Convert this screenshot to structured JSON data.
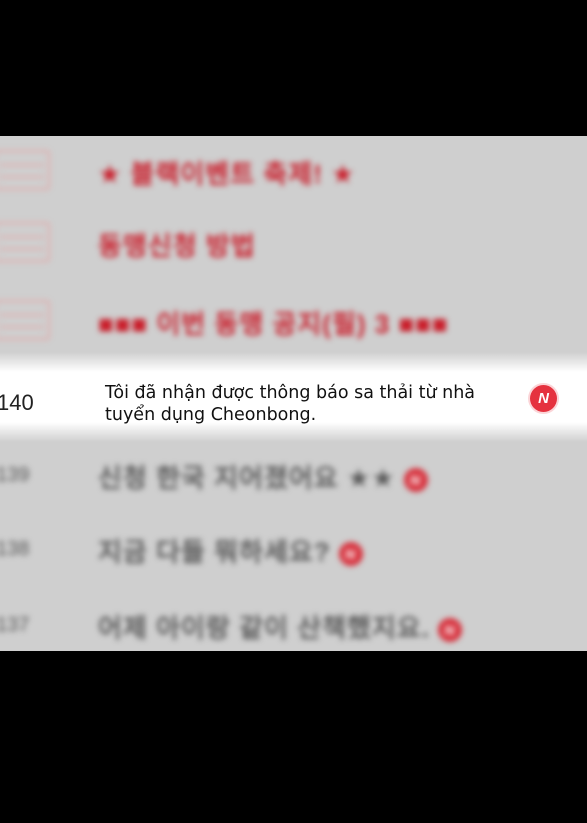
{
  "board": {
    "top_rows": [
      {
        "text": "★ 블랙이벤트 축제! ★"
      },
      {
        "text": "동맹신청 방법"
      },
      {
        "text": "■■■ 이번 동맹 공지(필) 3 ■■■"
      }
    ],
    "highlighted": {
      "number": "140",
      "title": "Tôi đã nhận được thông báo sa thải từ nhà tuyển dụng Cheonbong.",
      "badge": "N"
    },
    "bottom_rows": [
      {
        "number": "139",
        "text": "신청 한국 지어졌어요 ★★",
        "badge": "N"
      },
      {
        "number": "138",
        "text": "지금 다들 뭐하세요?",
        "badge": "N"
      },
      {
        "number": "137",
        "text": "어제 아이랑 같이 산책했지요.",
        "badge": "N"
      }
    ]
  },
  "colors": {
    "accent_red": "#c91e2b",
    "badge_red": "#e5323f",
    "background": "#000000",
    "board_gray": "#cfcfcf"
  }
}
